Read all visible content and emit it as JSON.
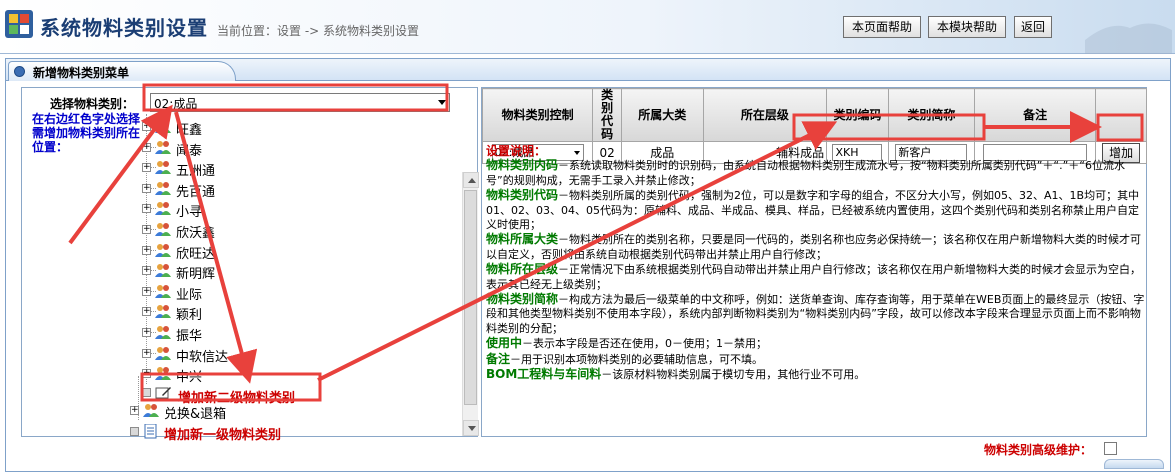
{
  "header": {
    "title": "系统物料类别设置",
    "location": "当前位置：设置 -> 系统物料类别设置",
    "buttons": {
      "page_help": "本页面帮助",
      "module_help": "本模块帮助",
      "back": "返回"
    }
  },
  "tab": {
    "label": "新增物料类别菜单"
  },
  "left": {
    "select_label": "选择物料类别：",
    "select_value": "02:成品",
    "hint": "在右边红色字处选择需增加物料类别所在位置：",
    "tree_items": [
      "旺鑫",
      "闻泰",
      "五洲通",
      "先百通",
      "小寻",
      "欣沃鑫",
      "欣旺达",
      "新明辉",
      "业际",
      "颖利",
      "振华",
      "中软信达",
      "中兴"
    ],
    "add_second_level": "增加新二级物料类别",
    "exchange_box": "兑换&退箱",
    "add_first_level": "增加新一级物料类别"
  },
  "table": {
    "headers": [
      "物料类别控制",
      "类别代码",
      "所属大类",
      "所在层级",
      "类别编码",
      "类别简称",
      "备注",
      ""
    ],
    "row": {
      "control_value": "02:成品",
      "code": "02",
      "category": "成品",
      "level": "辅料成品",
      "encoding": "XKH",
      "short_name": "新客户",
      "remark": "",
      "add_button": "增加"
    }
  },
  "notes": {
    "title": "设置说明：",
    "items": [
      {
        "term": "物料类别内码",
        "text": "－系统读取物料类别时的识别码，由系统自动根据物料类别生成流水号，按“物料类别所属类别代码”＋“.”＋“6位流水号”的规则构成，无需手工录入并禁止修改；"
      },
      {
        "term": "物料类别代码",
        "text": "－物料类别所属的类别代码，强制为2位，可以是数字和字母的组合，不区分大小写，例如05、32、A1、1B均可；其中01、02、03、04、05代码为：原辅料、成品、半成品、模具、样品，已经被系统内置使用，这四个类别代码和类别名称禁止用户自定义时使用；"
      },
      {
        "term": "物料所属大类",
        "text": "－物料类别所在的类别名称，只要是同一代码的，类别名称也应务必保持统一；该名称仅在用户新增物料大类的时候才可以自定义，否则将由系统自动根据类别代码带出并禁止用户自行修改；"
      },
      {
        "term": "物料所在层级",
        "text": "－正常情况下由系统根据类别代码自动带出并禁止用户自行修改；该名称仅在用户新增物料大类的时候才会显示为空白，表示其已经无上级类别；"
      },
      {
        "term": "物料类别简称",
        "text": "－构成方法为最后一级菜单的中文称呼，例如：送货单查询、库存查询等，用于菜单在WEB页面上的最终显示（按钮、字段和其他类型物料类别不使用本字段），系统内部判断物料类别为“物料类别内码”字段，故可以修改本字段来合理显示页面上而不影响物料类别的分配；"
      },
      {
        "term": "使用中",
        "text": "－表示本字段是否还在使用，0－使用；1－禁用；"
      },
      {
        "term": "备注",
        "text": "－用于识别本项物料类别的必要辅助信息，可不填。"
      },
      {
        "term": "BOM工程料与车间料",
        "text": "－该原材料物料类别属于模切专用，其他行业不可用。"
      }
    ]
  },
  "footer": {
    "advanced_label": "物料类别高级维护："
  },
  "colors": {
    "annotation_red": "#e8413c",
    "title_blue": "#1b3e74",
    "hint_blue": "#0000cc",
    "term_green": "#007a00",
    "warn_red": "#cc0000"
  },
  "icons": [
    "app-logo-icon",
    "tab-gear-icon",
    "people-icon",
    "pen-icon",
    "document-icon",
    "handshake-icon",
    "checkbox-icon"
  ]
}
